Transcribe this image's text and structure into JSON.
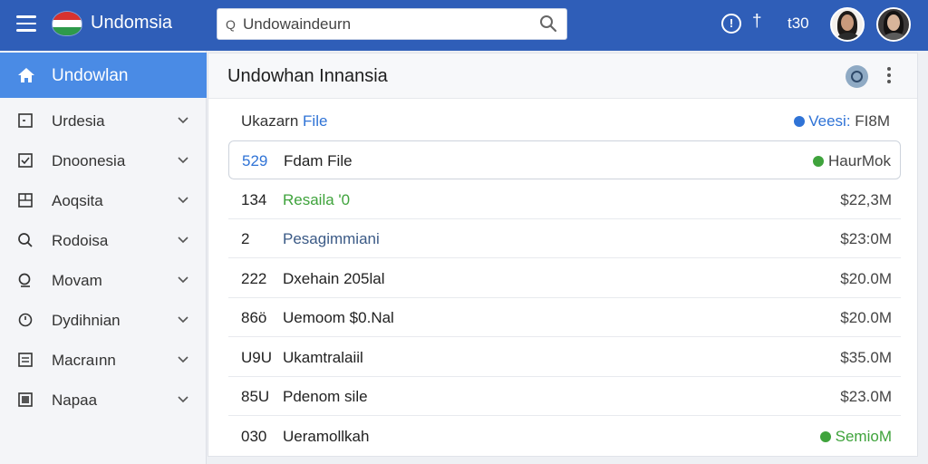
{
  "topbar": {
    "brand": "Undomsia",
    "search_value": "Undowaindeurn",
    "search_prefix": "Q",
    "count_text": "t30",
    "colors": {
      "bar": "#2f5eb8",
      "accent": "#2f73d6",
      "positive": "#3fa33c"
    }
  },
  "sidebar": {
    "home_label": "Undowlan",
    "items": [
      {
        "label": "Urdesia",
        "icon": "square-outline-icon"
      },
      {
        "label": "Dnoonesia",
        "icon": "checkbox-icon"
      },
      {
        "label": "Aoqsita",
        "icon": "grid-icon"
      },
      {
        "label": "Rodoisa",
        "icon": "search-icon"
      },
      {
        "label": "Movam",
        "icon": "search-alt-icon"
      },
      {
        "label": "Dydihnian",
        "icon": "clock-icon"
      },
      {
        "label": "Macraınn",
        "icon": "list-icon"
      },
      {
        "label": "Napaa",
        "icon": "square-filled-icon"
      }
    ]
  },
  "panel": {
    "title": "Undowhan Innansia",
    "sub_left_prefix": "Ukazarn ",
    "sub_left_accent": "File",
    "sub_right_accent": "Veesi:",
    "sub_right_value": " FI8M",
    "rows": [
      {
        "num": "529",
        "name": "Fdam File",
        "amount": "HaurMok",
        "selected": true,
        "amount_dot": true
      },
      {
        "num": "134",
        "name": "Resaila '0",
        "amount": "$22,3M"
      },
      {
        "num": "2",
        "name": "Pesagimmiani",
        "amount": "$23:0M"
      },
      {
        "num": "222",
        "name": "Dxehain 205lal",
        "amount": "$20.0M"
      },
      {
        "num": "86ö",
        "name": "Uemoom $0.Nal",
        "amount": "$20.0M"
      },
      {
        "num": "U9U",
        "name": "Ukamtralaiil",
        "amount": "$35.0M"
      },
      {
        "num": "85U",
        "name": "Pdenom sile",
        "amount": "$23.0M"
      },
      {
        "num": "030",
        "name": "Ueramollkah",
        "amount": "SemioM",
        "amount_dot": true
      }
    ]
  }
}
